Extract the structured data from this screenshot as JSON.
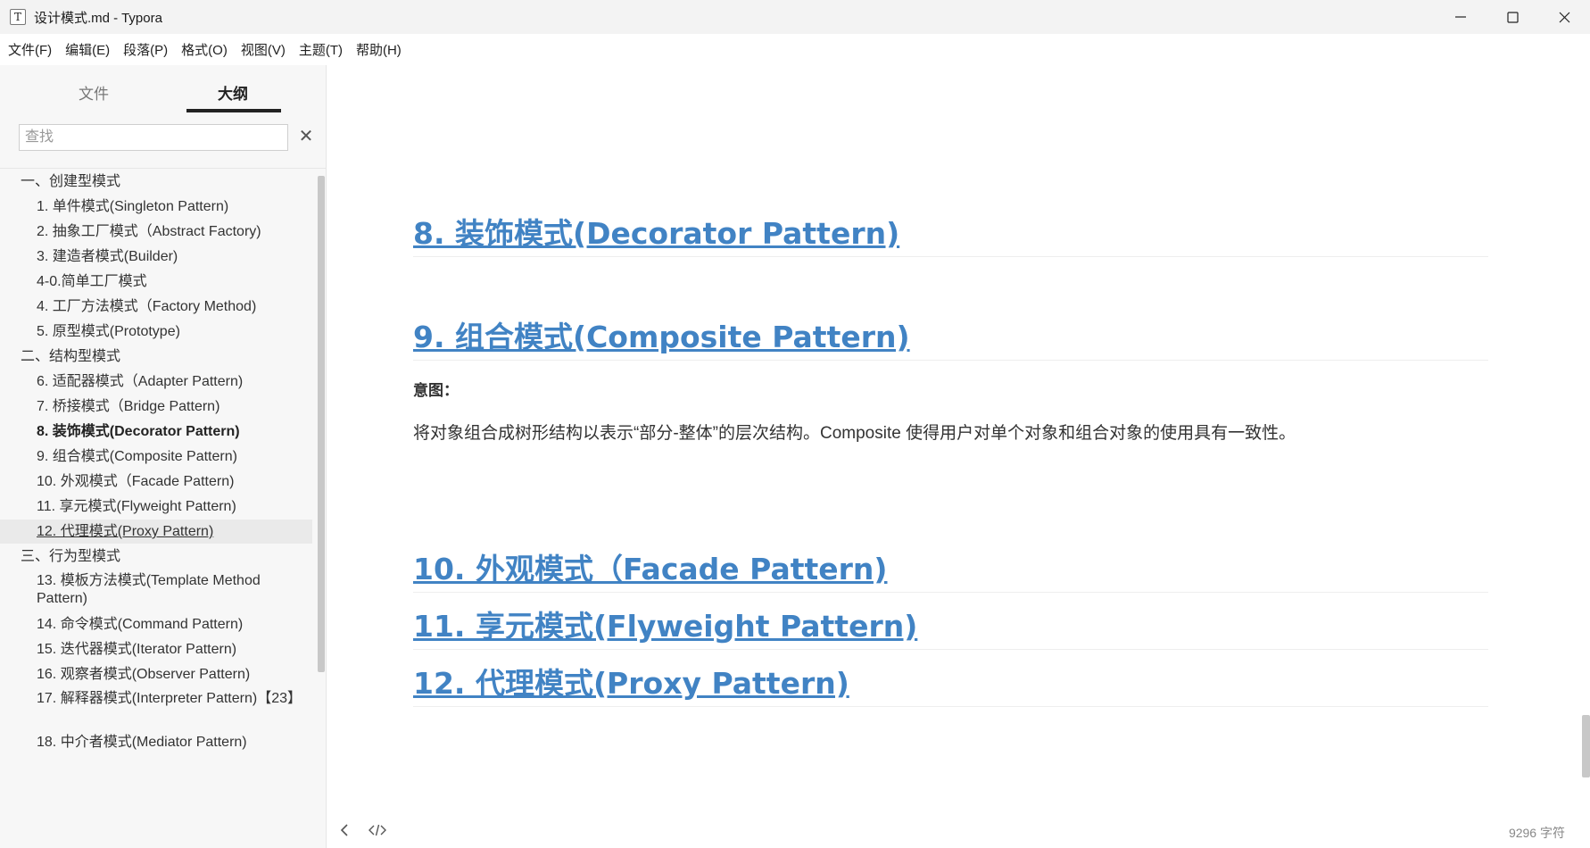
{
  "window": {
    "title": "设计模式.md - Typora",
    "app_icon_glyph": "T",
    "controls": [
      "minimize-icon",
      "maximize-icon",
      "close-icon"
    ]
  },
  "menu": [
    "文件(F)",
    "编辑(E)",
    "段落(P)",
    "格式(O)",
    "视图(V)",
    "主题(T)",
    "帮助(H)"
  ],
  "sidebar": {
    "tabs": {
      "files": "文件",
      "outline": "大纲"
    },
    "active_tab": "outline",
    "search_placeholder": "查找",
    "search_value": "",
    "outline": [
      {
        "label": "一、创建型模式",
        "level": 1
      },
      {
        "label": "1. 单件模式(Singleton Pattern)",
        "level": 2
      },
      {
        "label": "2. 抽象工厂模式（Abstract Factory)",
        "level": 2
      },
      {
        "label": "3. 建造者模式(Builder)",
        "level": 2
      },
      {
        "label": "4-0.简单工厂模式",
        "level": 2
      },
      {
        "label": "4. 工厂方法模式（Factory Method)",
        "level": 2
      },
      {
        "label": "5. 原型模式(Prototype)",
        "level": 2
      },
      {
        "label": "二、结构型模式",
        "level": 1
      },
      {
        "label": "6. 适配器模式（Adapter Pattern)",
        "level": 2
      },
      {
        "label": "7. 桥接模式（Bridge Pattern)",
        "level": 2
      },
      {
        "label": "8. 装饰模式(Decorator Pattern)",
        "level": 2,
        "state": "active"
      },
      {
        "label": "9. 组合模式(Composite Pattern)",
        "level": 2
      },
      {
        "label": "10. 外观模式（Facade Pattern)",
        "level": 2
      },
      {
        "label": "11. 享元模式(Flyweight Pattern)",
        "level": 2
      },
      {
        "label": "12. 代理模式(Proxy Pattern)",
        "level": 2,
        "state": "hover"
      },
      {
        "label": "三、行为型模式",
        "level": 1
      },
      {
        "label": "13. 模板方法模式(Template Method Pattern)",
        "level": 2
      },
      {
        "label": "14. 命令模式(Command Pattern)",
        "level": 2
      },
      {
        "label": "15. 迭代器模式(Iterator Pattern)",
        "level": 2
      },
      {
        "label": "16. 观察者模式(Observer Pattern)",
        "level": 2
      },
      {
        "label": "17. 解释器模式(Interpreter Pattern)【23】",
        "level": 2
      },
      {
        "label": "18. 中介者模式(Mediator Pattern)",
        "level": 2
      }
    ]
  },
  "document": {
    "headings": {
      "h8": "8. 装饰模式(Decorator Pattern)",
      "h9": "9. 组合模式(Composite Pattern)",
      "h10": "10. 外观模式（Facade Pattern)",
      "h11": "11. 享元模式(Flyweight Pattern)",
      "h12": "12. 代理模式(Proxy Pattern)"
    },
    "intent_label": "意图：",
    "intent_text": "将对象组合成树形结构以表示“部分-整体”的层次结构。Composite 使得用户对单个对象和组合对象的使用具有一致性。"
  },
  "footer": {
    "back_icon": "chevron-left-icon",
    "source_icon": "code-icon",
    "word_count": "9296 字符"
  },
  "colors": {
    "heading_link": "#4183c4",
    "sidebar_bg": "#f7f7f7",
    "titlebar_bg": "#f3f3f3"
  }
}
